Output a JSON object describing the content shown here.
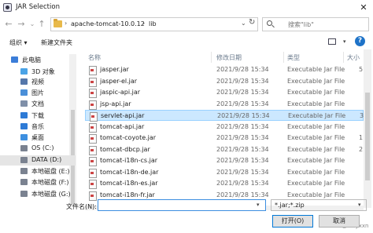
{
  "window": {
    "title": "JAR Selection"
  },
  "address": {
    "crumbs": [
      "apache-tomcat-10.0.12",
      "lib"
    ],
    "search_placeholder": "搜索\"lib\""
  },
  "toolbar": {
    "organize": "组织 ▾",
    "new_folder": "新建文件夹"
  },
  "sidebar": {
    "items": [
      {
        "label": "此电脑",
        "icon": "computer-icon",
        "color": "#3b7dd8"
      },
      {
        "label": "3D 对象",
        "icon": "cube-icon",
        "color": "#4aa3e6"
      },
      {
        "label": "视频",
        "icon": "video-icon",
        "color": "#5577aa"
      },
      {
        "label": "图片",
        "icon": "picture-icon",
        "color": "#4a8fd8"
      },
      {
        "label": "文档",
        "icon": "document-icon",
        "color": "#7f8fa8"
      },
      {
        "label": "下载",
        "icon": "download-icon",
        "color": "#2e7bd6"
      },
      {
        "label": "音乐",
        "icon": "music-icon",
        "color": "#2e7bd6"
      },
      {
        "label": "桌面",
        "icon": "desktop-icon",
        "color": "#3d8fe0"
      },
      {
        "label": "OS (C:)",
        "icon": "drive-icon",
        "color": "#7a8290"
      },
      {
        "label": "DATA (D:)",
        "icon": "drive-icon",
        "color": "#7a8290"
      },
      {
        "label": "本地磁盘 (E:)",
        "icon": "drive-icon",
        "color": "#7a8290"
      },
      {
        "label": "本地磁盘 (F:)",
        "icon": "drive-icon",
        "color": "#7a8290"
      },
      {
        "label": "本地磁盘 (G:)",
        "icon": "drive-icon",
        "color": "#7a8290"
      }
    ]
  },
  "columns": {
    "name": "名称",
    "modified": "修改日期",
    "type": "类型",
    "size": "大小"
  },
  "files": [
    {
      "name": "jasper.jar",
      "date": "2021/9/28 15:34",
      "type": "Executable Jar File",
      "size": "5"
    },
    {
      "name": "jasper-el.jar",
      "date": "2021/9/28 15:34",
      "type": "Executable Jar File",
      "size": ""
    },
    {
      "name": "jaspic-api.jar",
      "date": "2021/9/28 15:34",
      "type": "Executable Jar File",
      "size": ""
    },
    {
      "name": "jsp-api.jar",
      "date": "2021/9/28 15:34",
      "type": "Executable Jar File",
      "size": ""
    },
    {
      "name": "servlet-api.jar",
      "date": "2021/9/28 15:34",
      "type": "Executable Jar File",
      "size": "3"
    },
    {
      "name": "tomcat-api.jar",
      "date": "2021/9/28 15:34",
      "type": "Executable Jar File",
      "size": ""
    },
    {
      "name": "tomcat-coyote.jar",
      "date": "2021/9/28 15:34",
      "type": "Executable Jar File",
      "size": "1"
    },
    {
      "name": "tomcat-dbcp.jar",
      "date": "2021/9/28 15:34",
      "type": "Executable Jar File",
      "size": "2"
    },
    {
      "name": "tomcat-i18n-cs.jar",
      "date": "2021/9/28 15:34",
      "type": "Executable Jar File",
      "size": ""
    },
    {
      "name": "tomcat-i18n-de.jar",
      "date": "2021/9/28 15:34",
      "type": "Executable Jar File",
      "size": ""
    },
    {
      "name": "tomcat-i18n-es.jar",
      "date": "2021/9/28 15:34",
      "type": "Executable Jar File",
      "size": ""
    },
    {
      "name": "tomcat-i18n-fr.jar",
      "date": "2021/9/28 15:34",
      "type": "Executable Jar File",
      "size": ""
    }
  ],
  "selected_file": "servlet-api.jar",
  "bottom": {
    "filename_label": "文件名(N):",
    "filename_value": "",
    "filetype": "*.jar;*.zip",
    "open": "打开(O)",
    "cancel": "取消",
    "watermark": "CSDN @kblyxxn"
  }
}
